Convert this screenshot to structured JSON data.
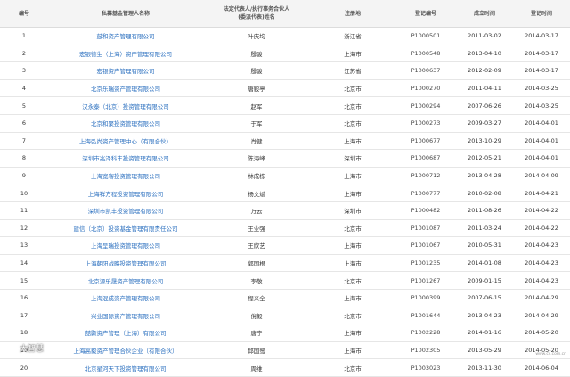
{
  "headers": {
    "no": "编号",
    "name": "私募基金管理人名称",
    "rep_line1": "法定代表人/执行事务合伙人",
    "rep_line2": "(委派代表)姓名",
    "place": "注册地",
    "reg": "登记编号",
    "est": "成立时间",
    "regdate": "登记时间"
  },
  "rows": [
    {
      "no": "1",
      "name": "鼓和资产管理有限公司",
      "rep": "叶庆均",
      "place": "浙江省",
      "reg": "P1000501",
      "est": "2011-03-02",
      "regdate": "2014-03-17"
    },
    {
      "no": "2",
      "name": "宏银德生（上海）资产管理有限公司",
      "rep": "殷骏",
      "place": "上海市",
      "reg": "P1000548",
      "est": "2013-04-10",
      "regdate": "2014-03-17"
    },
    {
      "no": "3",
      "name": "宏银资产管理有限公司",
      "rep": "殷骏",
      "place": "江苏省",
      "reg": "P1000637",
      "est": "2012-02-09",
      "regdate": "2014-03-17"
    },
    {
      "no": "4",
      "name": "北京乐瑞资产管理有限公司",
      "rep": "唐毅亭",
      "place": "北京市",
      "reg": "P1000270",
      "est": "2011-04-11",
      "regdate": "2014-03-25"
    },
    {
      "no": "5",
      "name": "汉永泰（北京）投资管理有限公司",
      "rep": "赵军",
      "place": "北京市",
      "reg": "P1000294",
      "est": "2007-06-26",
      "regdate": "2014-03-25"
    },
    {
      "no": "6",
      "name": "北京和聚投资管理有限公司",
      "rep": "于军",
      "place": "北京市",
      "reg": "P1000273",
      "est": "2009-03-27",
      "regdate": "2014-04-01"
    },
    {
      "no": "7",
      "name": "上海弘尚资产管理中心（有限合伙）",
      "rep": "肖健",
      "place": "上海市",
      "reg": "P1000677",
      "est": "2013-10-29",
      "regdate": "2014-04-01"
    },
    {
      "no": "8",
      "name": "深圳市兆泽科丰投资管理有限公司",
      "rep": "陈海峰",
      "place": "深圳市",
      "reg": "P1000687",
      "est": "2012-05-21",
      "regdate": "2014-04-01"
    },
    {
      "no": "9",
      "name": "上海宽客投资管理有限公司",
      "rep": "林成栋",
      "place": "上海市",
      "reg": "P1000712",
      "est": "2013-04-28",
      "regdate": "2014-04-09"
    },
    {
      "no": "10",
      "name": "上海祥方程投资管理有限公司",
      "rep": "杨文斌",
      "place": "上海市",
      "reg": "P1000777",
      "est": "2010-02-08",
      "regdate": "2014-04-21"
    },
    {
      "no": "11",
      "name": "深圳市凯丰投资管理有限公司",
      "rep": "万云",
      "place": "深圳市",
      "reg": "P1000482",
      "est": "2011-08-26",
      "regdate": "2014-04-22"
    },
    {
      "no": "12",
      "name": "建信（北京）投资基金管理有限责任公司",
      "rep": "王业强",
      "place": "北京市",
      "reg": "P1001087",
      "est": "2011-03-24",
      "regdate": "2014-04-22"
    },
    {
      "no": "13",
      "name": "上海呈瑞投资管理有限公司",
      "rep": "王欣艺",
      "place": "上海市",
      "reg": "P1001067",
      "est": "2010-05-31",
      "regdate": "2014-04-23"
    },
    {
      "no": "14",
      "name": "上海朝阳战略投资管理有限公司",
      "rep": "郭国根",
      "place": "上海市",
      "reg": "P1001235",
      "est": "2014-01-08",
      "regdate": "2014-04-23"
    },
    {
      "no": "15",
      "name": "北京源乐晟资产管理有限公司",
      "rep": "李敬",
      "place": "北京市",
      "reg": "P1001267",
      "est": "2009-01-15",
      "regdate": "2014-04-23"
    },
    {
      "no": "16",
      "name": "上海混成资产管理有限公司",
      "rep": "程义全",
      "place": "上海市",
      "reg": "P1000399",
      "est": "2007-06-15",
      "regdate": "2014-04-29"
    },
    {
      "no": "17",
      "name": "兴业国际资产管理有限公司",
      "rep": "倪毅",
      "place": "北京市",
      "reg": "P1001644",
      "est": "2013-04-23",
      "regdate": "2014-04-29"
    },
    {
      "no": "18",
      "name": "喆颢资产管理（上海）有限公司",
      "rep": "唐宁",
      "place": "上海市",
      "reg": "P1002228",
      "est": "2014-01-16",
      "regdate": "2014-05-20"
    },
    {
      "no": "19",
      "name": "上海高毅资产管理合伙企业（有限合伙）",
      "rep": "邱国鹭",
      "place": "上海市",
      "reg": "P1002305",
      "est": "2013-05-29",
      "regdate": "2014-05-20"
    },
    {
      "no": "20",
      "name": "北京星河天下投资管理有限公司",
      "rep": "周维",
      "place": "北京市",
      "reg": "P1003023",
      "est": "2013-11-30",
      "regdate": "2014-06-04"
    }
  ],
  "watermark": {
    "text": "大智慧"
  },
  "source": {
    "text": "www.cs.com.cn"
  }
}
